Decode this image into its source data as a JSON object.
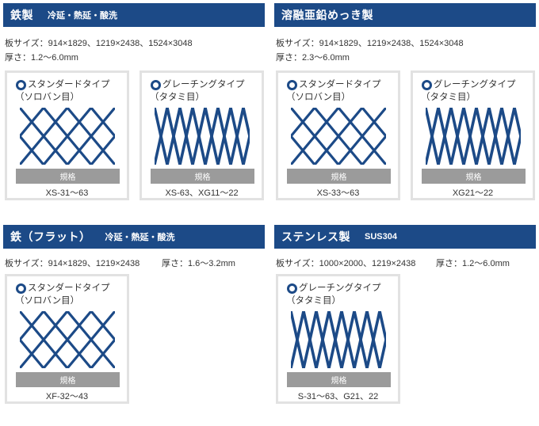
{
  "sections": [
    {
      "title": "鉄製",
      "subtitle": "冷延・熱延・酸洗",
      "size_spec": "板サイズ：914×1829、1219×2438、1524×3048",
      "thickness_spec": "厚さ：1.2〜6.0mm",
      "cards": [
        {
          "label": "スタンダードタイプ（ソロバン目）",
          "icon": "radio-ring-icon",
          "mesh": "diamond-mesh",
          "button": "規格",
          "code": "XS-31〜63"
        },
        {
          "label": "グレーチングタイプ（タタミ目）",
          "icon": "radio-ring-icon",
          "mesh": "grating-mesh",
          "button": "規格",
          "code": "XS-63、XG11〜22"
        }
      ]
    },
    {
      "title": "溶融亜鉛めっき製",
      "subtitle": "",
      "size_spec": "板サイズ：914×1829、1219×2438、1524×3048",
      "thickness_spec": "厚さ：2.3〜6.0mm",
      "cards": [
        {
          "label": "スタンダードタイプ（ソロバン目）",
          "icon": "radio-ring-icon",
          "mesh": "diamond-mesh",
          "button": "規格",
          "code": "XS-33〜63"
        },
        {
          "label": "グレーチングタイプ（タタミ目）",
          "icon": "radio-ring-icon",
          "mesh": "grating-mesh",
          "button": "規格",
          "code": "XG21〜22"
        }
      ]
    },
    {
      "title": "鉄（フラット）",
      "subtitle": "冷延・熱延・酸洗",
      "size_spec": "板サイズ：914×1829、1219×2438",
      "thickness_spec": "厚さ：1.6〜3.2mm",
      "cards": [
        {
          "label": "スタンダードタイプ（ソロバン目）",
          "icon": "radio-ring-icon",
          "mesh": "diamond-mesh",
          "button": "規格",
          "code": "XF-32〜43"
        }
      ]
    },
    {
      "title": "ステンレス製",
      "subtitle": "SUS304",
      "size_spec": "板サイズ：1000×2000、1219×2438",
      "thickness_spec": "厚さ：1.2〜6.0mm",
      "cards": [
        {
          "label": "グレーチングタイプ（タタミ目）",
          "icon": "radio-ring-icon",
          "mesh": "grating-mesh",
          "button": "規格",
          "code": "S-31〜63、G21、22"
        }
      ]
    }
  ],
  "colors": {
    "header_bg": "#1c4a87",
    "mesh_stroke": "#1c4a87",
    "button_bg": "#9b9b9b",
    "card_border": "#e2e2e2"
  }
}
